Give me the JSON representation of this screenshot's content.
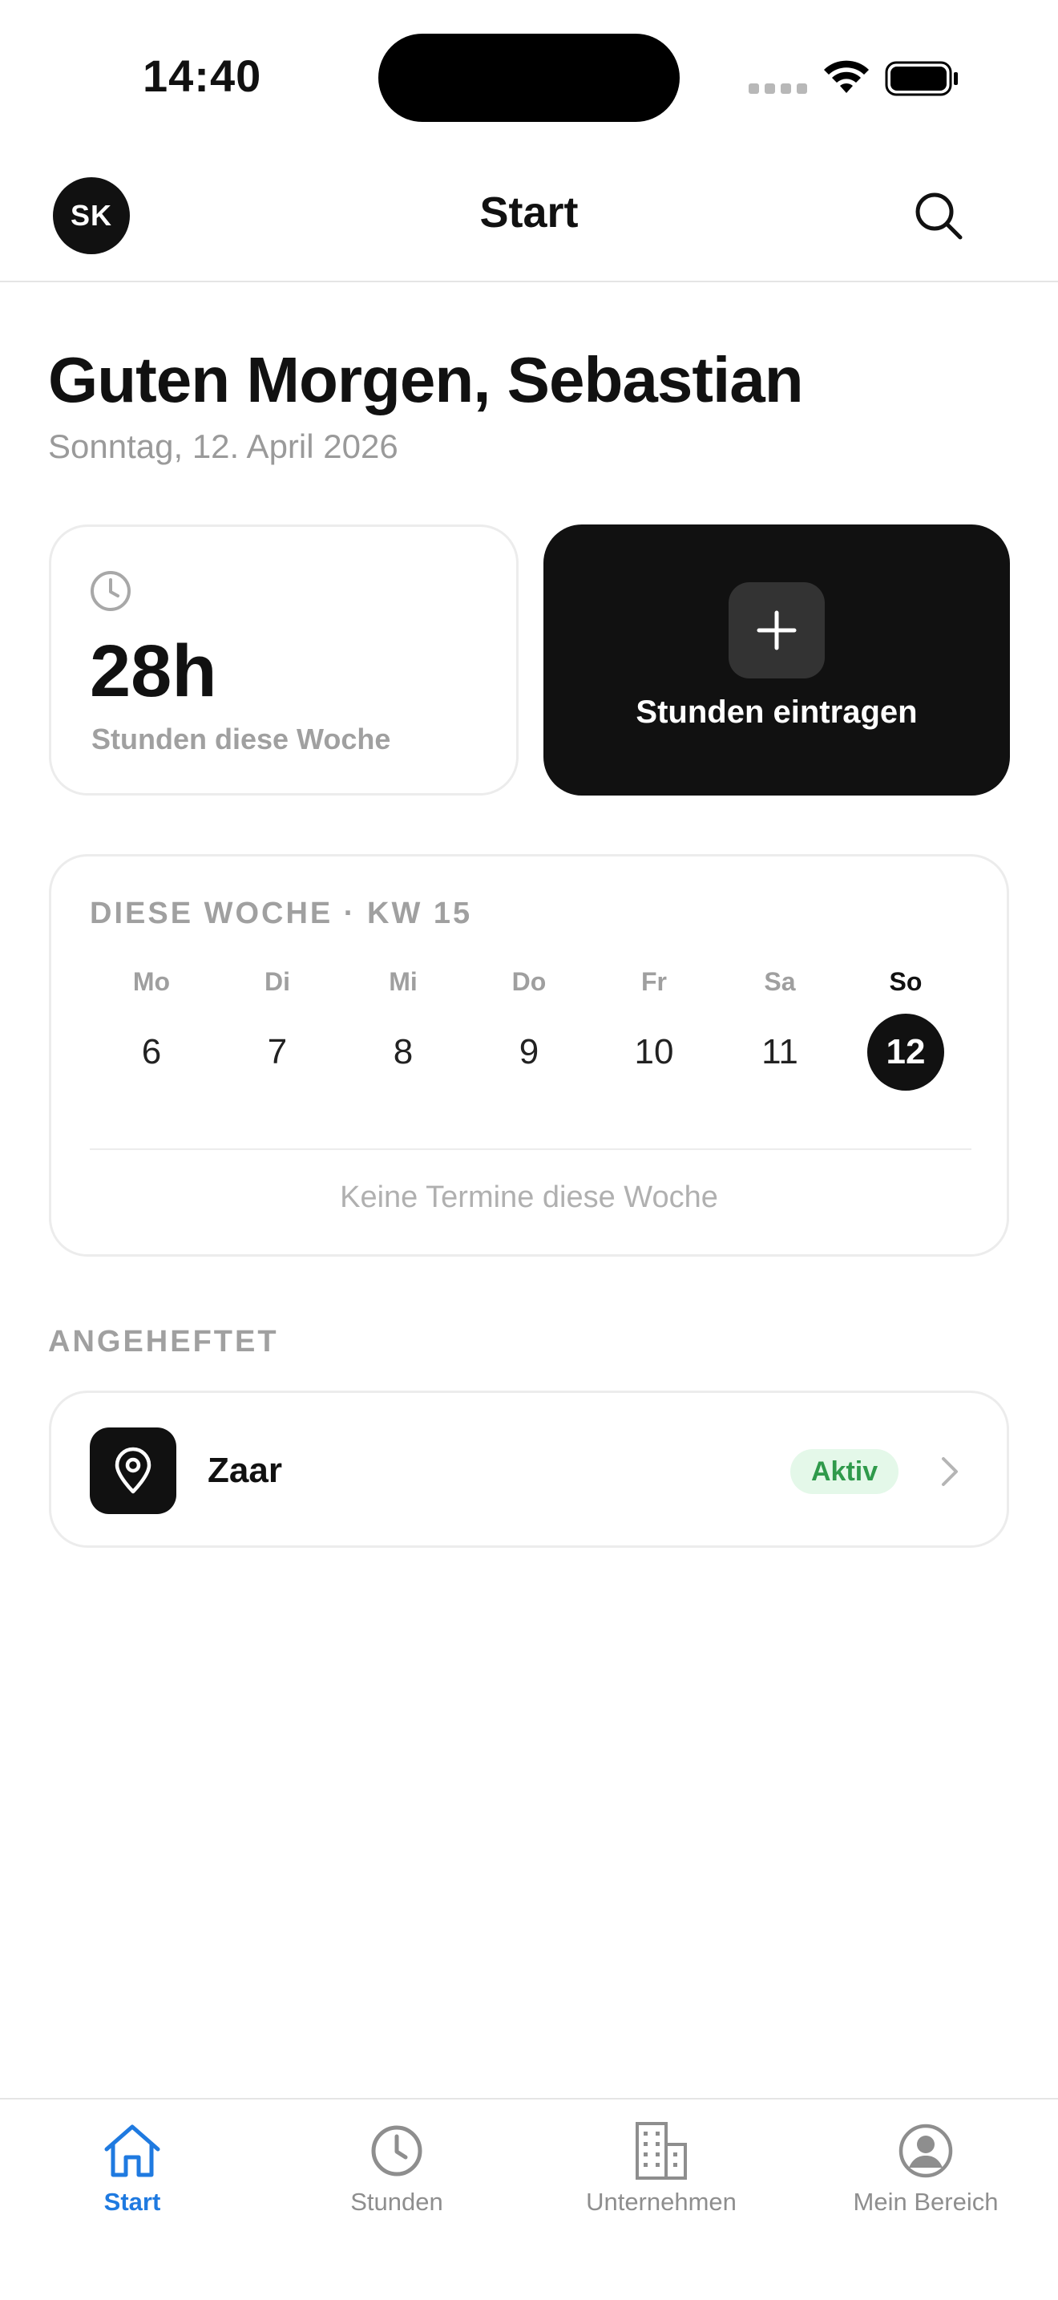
{
  "status_bar": {
    "time": "14:40"
  },
  "nav": {
    "avatar_initials": "SK",
    "title": "Start"
  },
  "greeting": {
    "headline": "Guten Morgen, Sebastian",
    "date": "Sonntag, 12. April 2026"
  },
  "hours_card": {
    "value": "28h",
    "label": "Stunden diese Woche"
  },
  "add_card": {
    "label": "Stunden eintragen"
  },
  "week": {
    "header": "DIESE WOCHE · KW 15",
    "days": [
      {
        "name": "Mo",
        "num": "6"
      },
      {
        "name": "Di",
        "num": "7"
      },
      {
        "name": "Mi",
        "num": "8"
      },
      {
        "name": "Do",
        "num": "9"
      },
      {
        "name": "Fr",
        "num": "10"
      },
      {
        "name": "Sa",
        "num": "11"
      },
      {
        "name": "So",
        "num": "12"
      }
    ],
    "today_index": 6,
    "empty_text": "Keine Termine diese Woche"
  },
  "pinned": {
    "header": "ANGEHEFTET",
    "items": [
      {
        "name": "Zaar",
        "status": "Aktiv",
        "icon": "location-pin-icon"
      }
    ]
  },
  "tabs": [
    {
      "label": "Start",
      "icon": "home-icon",
      "active": true
    },
    {
      "label": "Stunden",
      "icon": "clock-icon",
      "active": false
    },
    {
      "label": "Unternehmen",
      "icon": "building-icon",
      "active": false
    },
    {
      "label": "Mein Bereich",
      "icon": "profile-icon",
      "active": false
    }
  ],
  "colors": {
    "accent": "#1f7ae0",
    "dark": "#111111",
    "status_active_bg": "#e4f8e9",
    "status_active_text": "#2f9a4b"
  }
}
